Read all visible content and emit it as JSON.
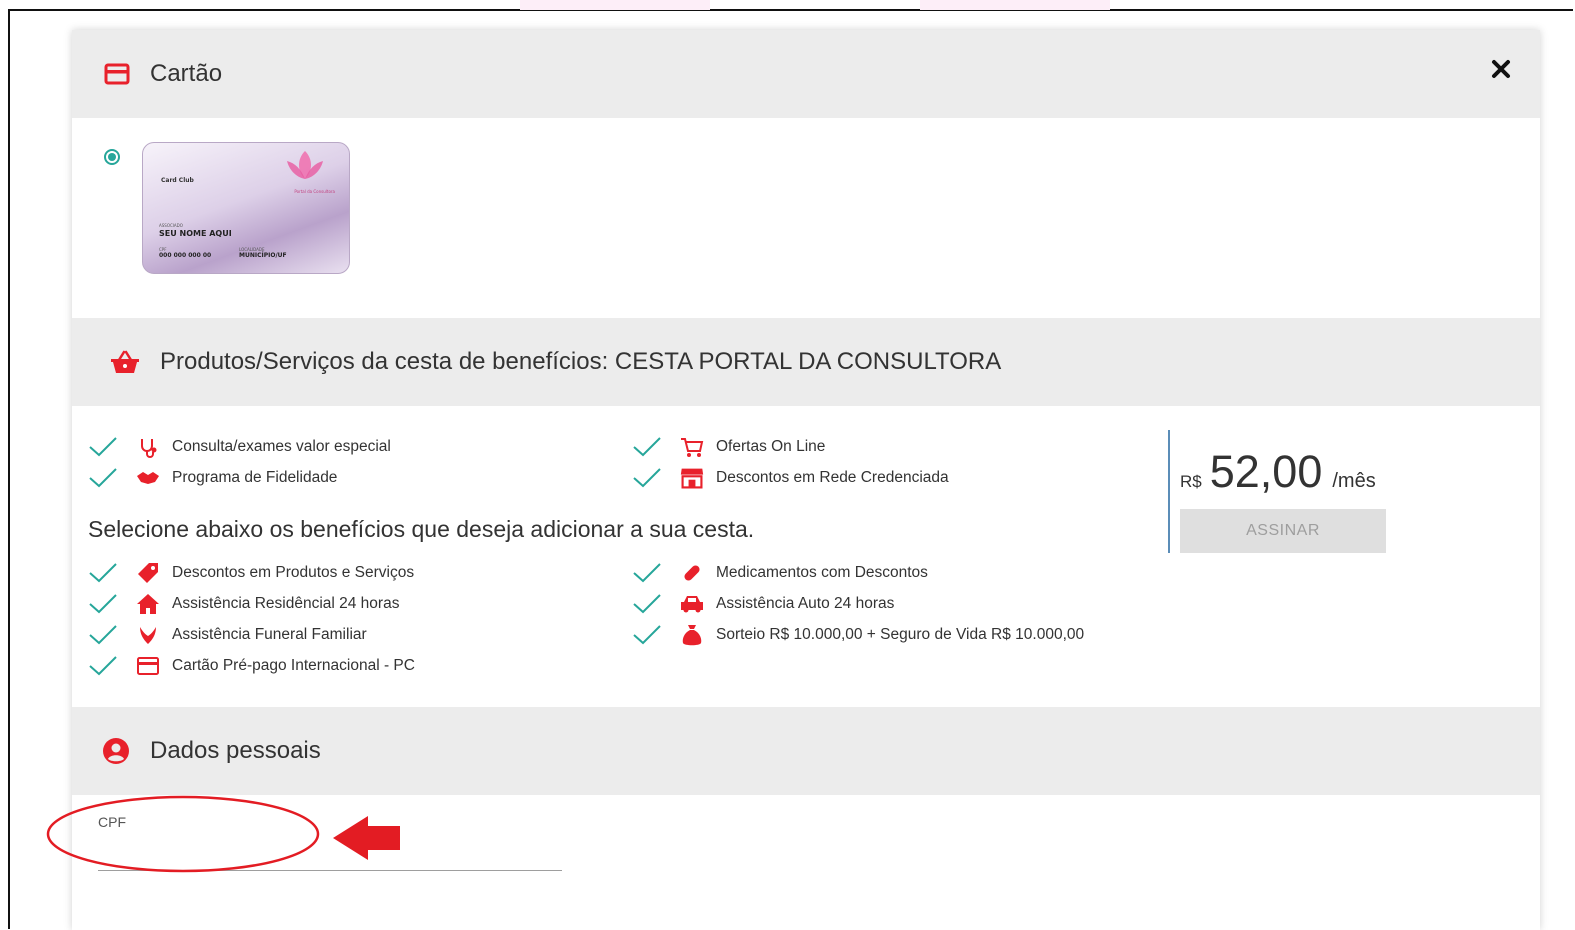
{
  "modal": {
    "card_section": {
      "title": "Cartão",
      "card_image": {
        "label_club": "Card Club",
        "label_associado": "ASSOCIADO",
        "name": "SEU NOME AQUI",
        "label_cpf": "CPF",
        "cpf": "000 000 000 00",
        "label_localidade": "LOCALIDADE",
        "location": "MUNICÍPIO/UF",
        "brand": "Portal da Consultora"
      }
    },
    "basket_section": {
      "title": "Produtos/Serviços da cesta de benefícios: CESTA PORTAL DA CONSULTORA",
      "included_benefits": [
        {
          "label": "Consulta/exames valor especial",
          "icon": "stethoscope-icon"
        },
        {
          "label": "Ofertas On Line",
          "icon": "shopping-cart-icon"
        },
        {
          "label": "Programa de Fidelidade",
          "icon": "handshake-icon"
        },
        {
          "label": "Descontos em Rede Credenciada",
          "icon": "store-icon"
        }
      ],
      "select_prompt": "Selecione abaixo os benefícios que deseja adicionar a sua cesta.",
      "optional_benefits": [
        {
          "label": "Descontos em Produtos e Serviços",
          "icon": "tag-icon"
        },
        {
          "label": "Medicamentos com Descontos",
          "icon": "pill-icon"
        },
        {
          "label": "Assistência Residêncial 24 horas",
          "icon": "home-icon"
        },
        {
          "label": "Assistência Auto 24 horas",
          "icon": "car-icon"
        },
        {
          "label": "Assistência Funeral Familiar",
          "icon": "wreath-icon"
        },
        {
          "label": "Sorteio R$ 10.000,00 + Seguro de Vida R$ 10.000,00",
          "icon": "money-bag-icon"
        },
        {
          "label": "Cartão Pré-pago Internacional - PC",
          "icon": "credit-card-icon"
        }
      ],
      "price": {
        "currency": "R$",
        "value": "52,00",
        "period": "/mês"
      },
      "subscribe_label": "ASSINAR"
    },
    "personal_section": {
      "title": "Dados pessoais",
      "cpf_label": "CPF",
      "cpf_value": ""
    }
  },
  "colors": {
    "accent_red": "#e8212b",
    "check_teal": "#26a69a",
    "header_gray": "#ececec",
    "divider_blue": "#5b8db8"
  }
}
